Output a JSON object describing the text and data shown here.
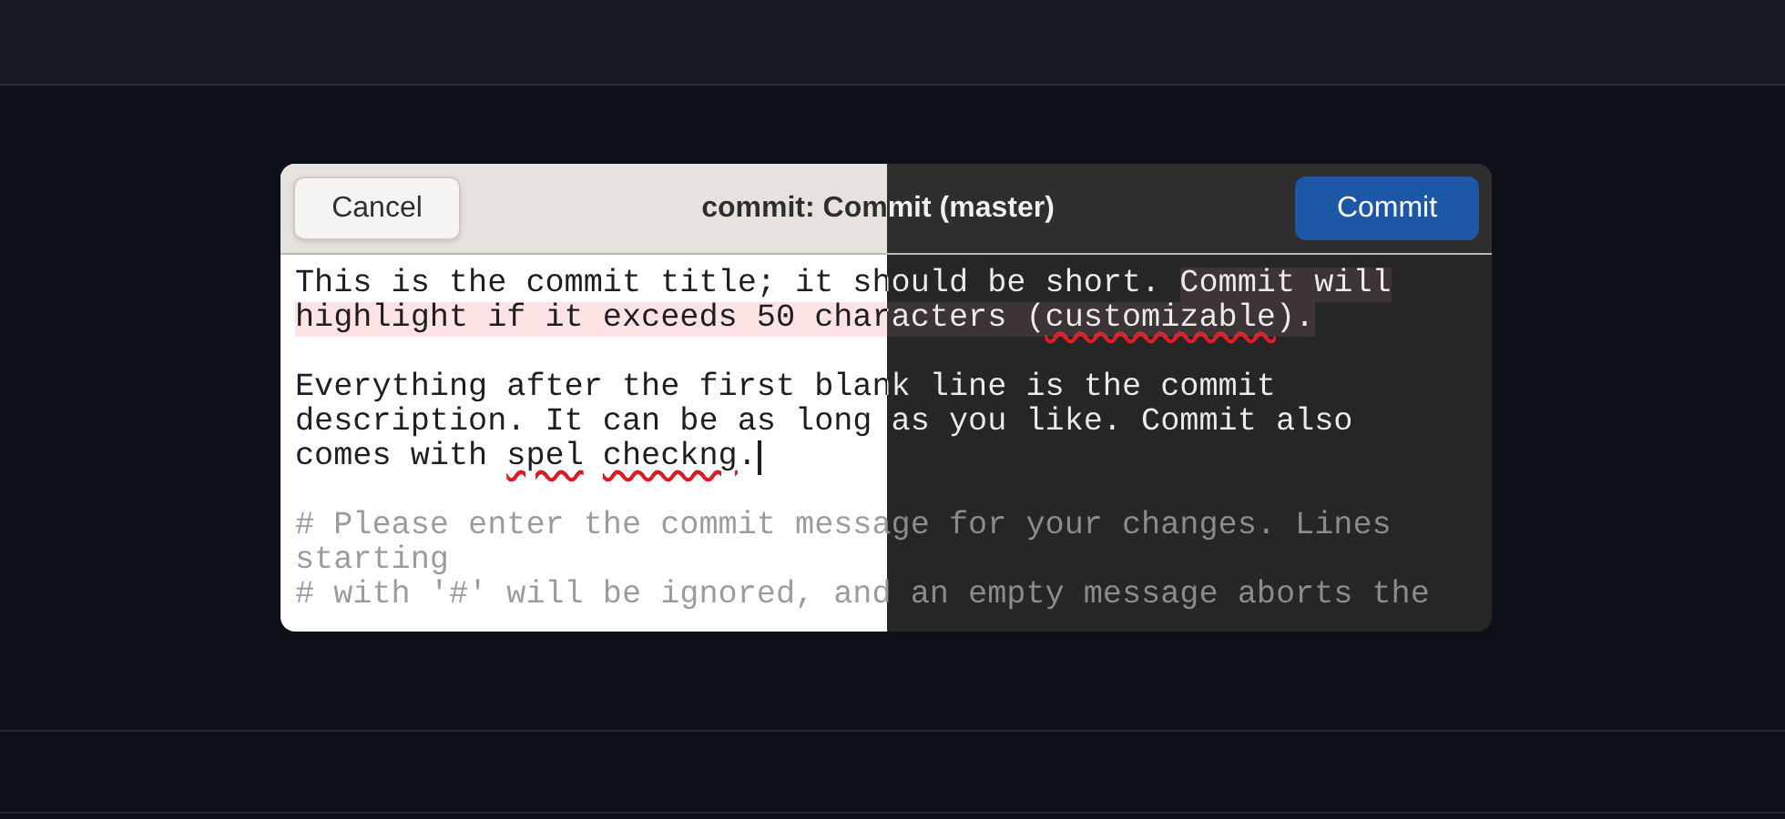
{
  "dialog": {
    "title": "commit: Commit (master)",
    "cancel_button": "Cancel",
    "commit_button": "Commit",
    "lines": [
      {
        "kind": "text",
        "segments": [
          {
            "text": "This is the commit title; it should be short. ",
            "over_limit": false,
            "misspelled": false
          },
          {
            "text": "Commit will",
            "over_limit": true,
            "misspelled": false
          }
        ]
      },
      {
        "kind": "text",
        "segments": [
          {
            "text": "highlight if it exceeds 50 characters (",
            "over_limit": true,
            "misspelled": false
          },
          {
            "text": "customizable",
            "over_limit": true,
            "misspelled": true
          },
          {
            "text": ").",
            "over_limit": true,
            "misspelled": false
          }
        ]
      },
      {
        "kind": "blank"
      },
      {
        "kind": "text",
        "segments": [
          {
            "text": "Everything after the first blank line is the commit",
            "over_limit": false,
            "misspelled": false
          }
        ]
      },
      {
        "kind": "text",
        "segments": [
          {
            "text": "description. It can be as long as you like. Commit also",
            "over_limit": false,
            "misspelled": false
          }
        ]
      },
      {
        "kind": "text",
        "cursor": true,
        "segments": [
          {
            "text": "comes with ",
            "over_limit": false,
            "misspelled": false
          },
          {
            "text": "spel",
            "over_limit": false,
            "misspelled": true
          },
          {
            "text": "checkng",
            "over_limit": false,
            "misspelled": true,
            "space_before": true
          },
          {
            "text": ".",
            "over_limit": false,
            "misspelled": false
          }
        ]
      },
      {
        "kind": "blank"
      },
      {
        "kind": "comment",
        "segments": [
          {
            "text": "# Please enter the commit message for your changes. Lines",
            "over_limit": false,
            "misspelled": false
          }
        ]
      },
      {
        "kind": "comment",
        "segments": [
          {
            "text": "starting",
            "over_limit": false,
            "misspelled": false
          }
        ]
      },
      {
        "kind": "comment",
        "segments": [
          {
            "text": "# with '#' will be ignored, and an empty message aborts the",
            "over_limit": false,
            "misspelled": false
          }
        ]
      }
    ]
  }
}
